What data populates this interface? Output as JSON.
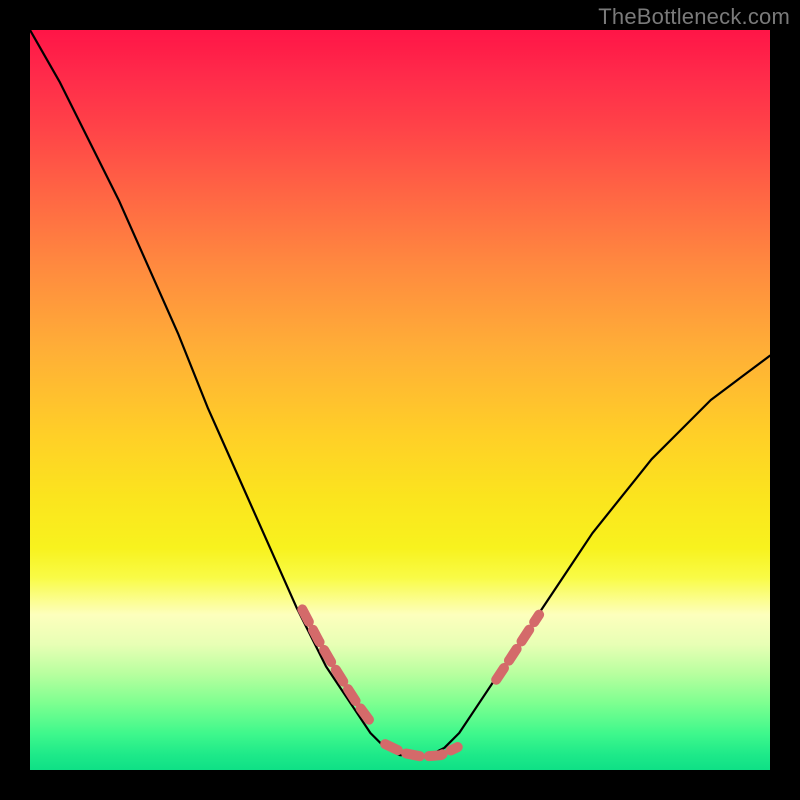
{
  "watermark": "TheBottleneck.com",
  "chart_data": {
    "type": "line",
    "title": "",
    "xlabel": "",
    "ylabel": "",
    "xlim": [
      0,
      1
    ],
    "ylim": [
      0,
      1
    ],
    "grid": false,
    "series": [
      {
        "name": "curve",
        "stroke": "#000000",
        "stroke_width": 2.2,
        "x": [
          0.0,
          0.04,
          0.08,
          0.12,
          0.16,
          0.2,
          0.24,
          0.28,
          0.32,
          0.36,
          0.4,
          0.42,
          0.44,
          0.46,
          0.48,
          0.5,
          0.52,
          0.54,
          0.56,
          0.58,
          0.6,
          0.64,
          0.68,
          0.72,
          0.76,
          0.8,
          0.84,
          0.88,
          0.92,
          0.96,
          1.0
        ],
        "y": [
          1.0,
          0.93,
          0.85,
          0.77,
          0.68,
          0.59,
          0.49,
          0.4,
          0.31,
          0.22,
          0.14,
          0.11,
          0.08,
          0.05,
          0.03,
          0.02,
          0.02,
          0.02,
          0.03,
          0.05,
          0.08,
          0.14,
          0.2,
          0.26,
          0.32,
          0.37,
          0.42,
          0.46,
          0.5,
          0.53,
          0.56
        ]
      },
      {
        "name": "left-dots",
        "stroke": "#d46a6a",
        "stroke_width": 10,
        "dash": [
          14,
          9
        ],
        "x": [
          0.368,
          0.39,
          0.408,
          0.428,
          0.444,
          0.464
        ],
        "y": [
          0.217,
          0.175,
          0.144,
          0.112,
          0.087,
          0.06
        ]
      },
      {
        "name": "bottom-dots",
        "stroke": "#d46a6a",
        "stroke_width": 10,
        "dash": [
          14,
          9
        ],
        "x": [
          0.48,
          0.505,
          0.53,
          0.555,
          0.578
        ],
        "y": [
          0.035,
          0.023,
          0.018,
          0.02,
          0.031
        ]
      },
      {
        "name": "right-dots",
        "stroke": "#d46a6a",
        "stroke_width": 10,
        "dash": [
          14,
          9
        ],
        "x": [
          0.63,
          0.648,
          0.665,
          0.688
        ],
        "y": [
          0.122,
          0.149,
          0.175,
          0.21
        ]
      }
    ],
    "gradient_stops": [
      {
        "offset": 0.0,
        "color": "#ff1547"
      },
      {
        "offset": 0.06,
        "color": "#ff2a4a"
      },
      {
        "offset": 0.13,
        "color": "#ff4248"
      },
      {
        "offset": 0.22,
        "color": "#ff6544"
      },
      {
        "offset": 0.32,
        "color": "#ff8a3f"
      },
      {
        "offset": 0.43,
        "color": "#ffae37"
      },
      {
        "offset": 0.55,
        "color": "#ffd027"
      },
      {
        "offset": 0.63,
        "color": "#fbe41e"
      },
      {
        "offset": 0.7,
        "color": "#f8f21e"
      },
      {
        "offset": 0.74,
        "color": "#f9fb46"
      },
      {
        "offset": 0.79,
        "color": "#fdffbd"
      },
      {
        "offset": 0.83,
        "color": "#e8ffb5"
      },
      {
        "offset": 0.87,
        "color": "#b8ff9f"
      },
      {
        "offset": 0.91,
        "color": "#7dff90"
      },
      {
        "offset": 0.95,
        "color": "#40f88c"
      },
      {
        "offset": 0.98,
        "color": "#1de989"
      },
      {
        "offset": 1.0,
        "color": "#0fe086"
      }
    ]
  }
}
